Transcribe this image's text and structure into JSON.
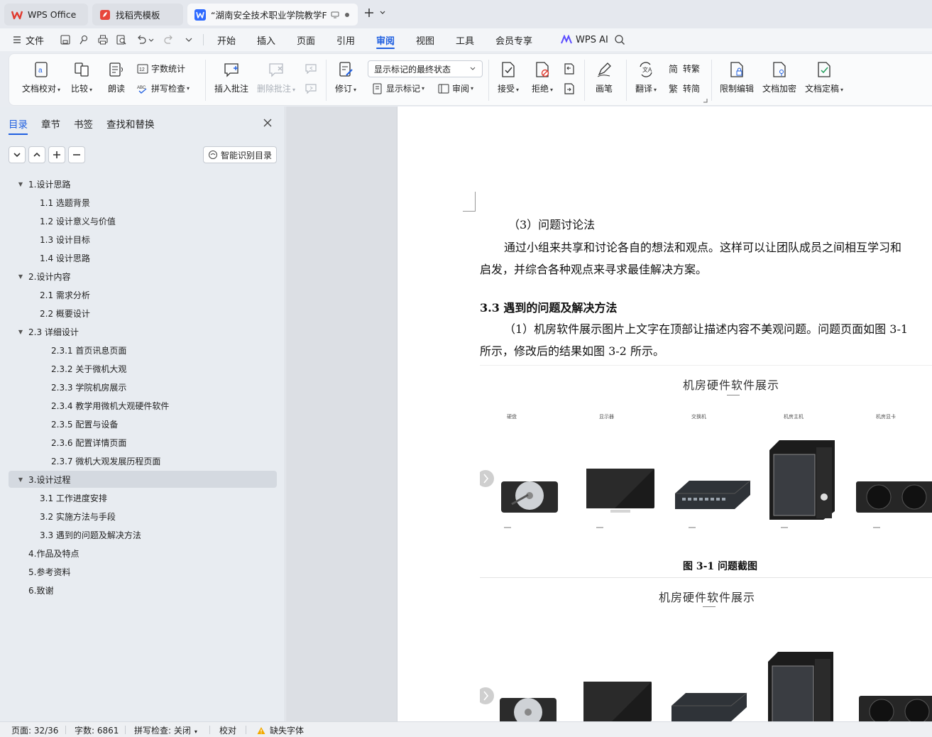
{
  "tabs": [
    {
      "label": "WPS Office",
      "icon": "wps-logo-icon"
    },
    {
      "label": "找稻壳模板",
      "icon": "docer-logo-icon"
    },
    {
      "label": "“湖南安全技术职业学院教学F",
      "icon": "writer-doc-icon",
      "active": true
    }
  ],
  "menu": {
    "file": "文件",
    "items": [
      "开始",
      "插入",
      "页面",
      "引用",
      "审阅",
      "视图",
      "工具",
      "会员专享"
    ],
    "active": "审阅",
    "ai": "WPS AI"
  },
  "ribbon": {
    "proofread": "文档校对",
    "compare": "比较",
    "read_aloud": "朗读",
    "word_count": "字数统计",
    "spell_check": "拼写检查",
    "insert_comment": "插入批注",
    "delete_comment": "删除批注",
    "track": "修订",
    "markup_state": "显示标记的最终状态",
    "show_markup": "显示标记",
    "review": "审阅",
    "accept": "接受",
    "reject": "拒绝",
    "pen": "画笔",
    "translate": "翻译",
    "to_traditional": "转繁",
    "to_simplified": "转简",
    "restrict": "限制编辑",
    "encrypt": "文档加密",
    "finalize": "文档定稿"
  },
  "nav": {
    "tabs": [
      "目录",
      "章节",
      "书签",
      "查找和替换"
    ],
    "smart_toc": "智能识别目录",
    "toc": [
      {
        "label": "1.设计思路",
        "level": 0,
        "arrow": true
      },
      {
        "label": "1.1 选题背景",
        "level": 1
      },
      {
        "label": "1.2 设计意义与价值",
        "level": 1
      },
      {
        "label": "1.3 设计目标",
        "level": 1
      },
      {
        "label": "1.4 设计思路",
        "level": 1
      },
      {
        "label": "2.设计内容",
        "level": 0,
        "arrow": true
      },
      {
        "label": "2.1 需求分析",
        "level": 1
      },
      {
        "label": "2.2 概要设计",
        "level": 1
      },
      {
        "label": "2.3 详细设计",
        "level": 0,
        "arrow": true
      },
      {
        "label": "2.3.1 首页讯息页面",
        "level": 2
      },
      {
        "label": "2.3.2 关于微机大观",
        "level": 2
      },
      {
        "label": "2.3.3 学院机房展示",
        "level": 2
      },
      {
        "label": "2.3.4 教学用微机大观硬件软件",
        "level": 2
      },
      {
        "label": "2.3.5 配置与设备",
        "level": 2
      },
      {
        "label": "2.3.6 配置详情页面",
        "level": 2
      },
      {
        "label": "2.3.7 微机大观发展历程页面",
        "level": 2
      },
      {
        "label": "3.设计过程",
        "level": 0,
        "arrow": true,
        "selected": true
      },
      {
        "label": "3.1 工作进度安排",
        "level": 1
      },
      {
        "label": "3.2 实施方法与手段",
        "level": 1
      },
      {
        "label": "3.3 遇到的问题及解决方法",
        "level": 1
      },
      {
        "label": "4.作品及特点",
        "level": 0
      },
      {
        "label": "5.参考资料",
        "level": 0
      },
      {
        "label": "6.致谢",
        "level": 0
      }
    ]
  },
  "doc": {
    "p1": "（3）问题讨论法",
    "p2": "通过小组来共享和讨论各自的想法和观点。这样可以让团队成员之间相互学习和",
    "p3": "启发，并综合各种观点来寻求最佳解决方案。",
    "h": "3.3 遇到的问题及解决方法",
    "p4": "（1）机房软件展示图片上文字在顶部让描述内容不美观问题。问题页面如图 3-1",
    "p5": "所示，修改后的结果如图 3-2 所示。",
    "fig_title": "机房硬件软件展示",
    "fig_labels": [
      "硬盘",
      "显示器",
      "交换机",
      "机房主机",
      "机房显卡"
    ],
    "caption1": "图 3-1 问题截图"
  },
  "status": {
    "page": "页面: 32/36",
    "words": "字数: 6861",
    "spell": "拼写检查: 关闭",
    "proof": "校对",
    "missing_font": "缺失字体"
  },
  "colors": {
    "accent": "#1f5fe0",
    "wps_red": "#e03a2f",
    "warning": "#f2a900"
  }
}
